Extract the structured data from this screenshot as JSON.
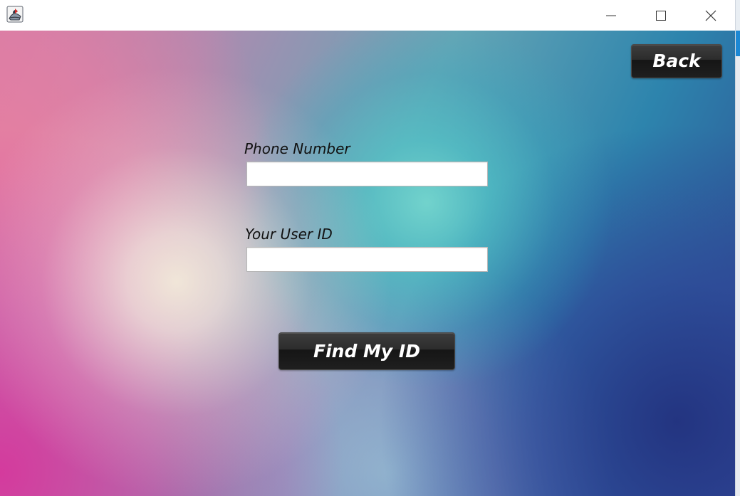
{
  "window": {
    "app_icon": "java-app-icon",
    "controls": {
      "minimize_icon": "minimize-icon",
      "maximize_icon": "maximize-icon",
      "close_icon": "close-icon"
    }
  },
  "form": {
    "phone_label": "Phone Number",
    "phone_value": "",
    "phone_placeholder": "",
    "user_id_label": "Your User ID",
    "user_id_value": "",
    "user_id_placeholder": "",
    "find_button_label": "Find My ID"
  },
  "navigation": {
    "back_button_label": "Back"
  },
  "colors": {
    "button_background": "#1f1f1f",
    "button_text": "#ffffff",
    "input_background": "#ffffff",
    "label_text": "#111111"
  }
}
